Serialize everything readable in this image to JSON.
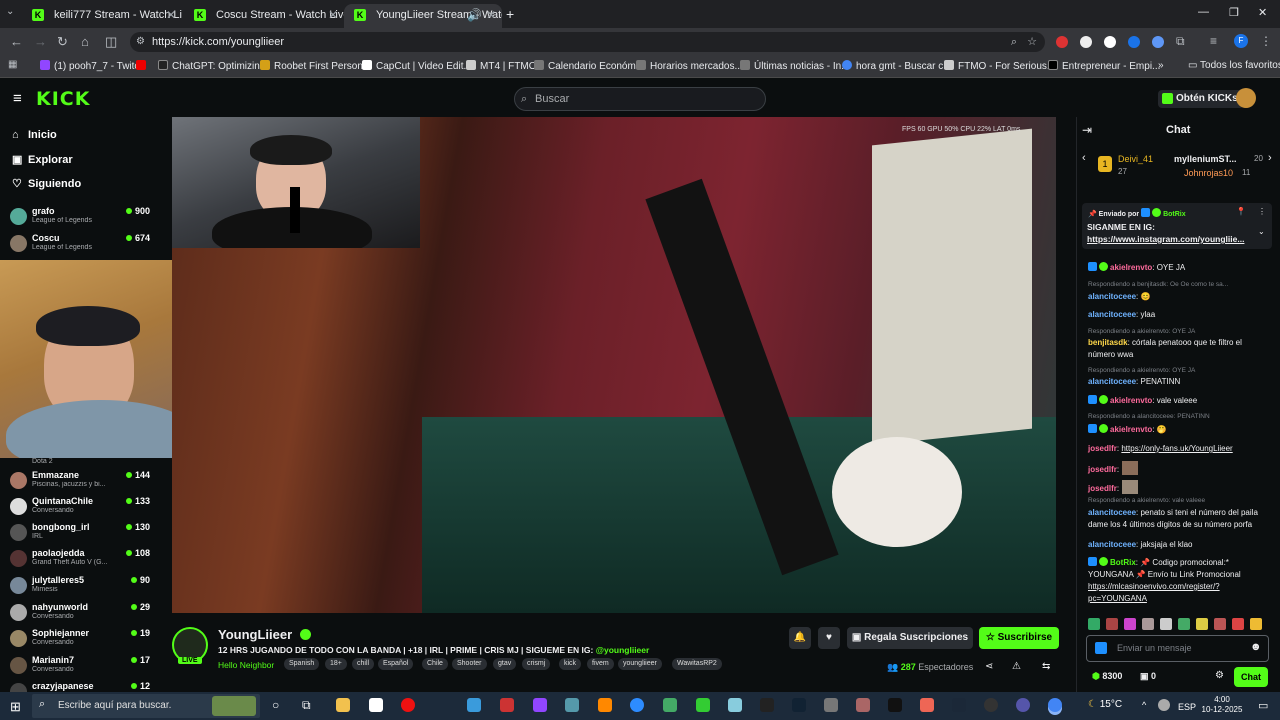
{
  "browser": {
    "tabs": [
      {
        "title": "keili777 Stream - Watch Live on Kick"
      },
      {
        "title": "Coscu Stream - Watch Live on Kick"
      },
      {
        "title": "YoungLiieer Stream - Watch Live on Kick"
      }
    ],
    "url": "https://kick.com/youngliieer",
    "bookmarks": [
      {
        "label": "(1) pooh7_7 - Twitch",
        "color": "#9146ff"
      },
      {
        "label": "ChatGPT: Optimizin...",
        "color": "#222"
      },
      {
        "label": "Roobet First Person...",
        "color": "#d4a017"
      },
      {
        "label": "CapCut | Video Edit...",
        "color": "#000"
      },
      {
        "label": "MT4 | FTMO",
        "color": "#ccc"
      },
      {
        "label": "Calendario Económi...",
        "color": "#555"
      },
      {
        "label": "Horarios mercados...",
        "color": "#555"
      },
      {
        "label": "Últimas noticias - In...",
        "color": "#555"
      },
      {
        "label": "hora gmt - Buscar c...",
        "color": "#4285f4"
      },
      {
        "label": "FTMO - For Serious...",
        "color": "#ccc"
      },
      {
        "label": "Entrepreneur - Empi...",
        "color": "#000"
      }
    ],
    "all_bookmarks": "Todos los favoritos"
  },
  "header": {
    "logo": "KICK",
    "search_placeholder": "Buscar",
    "get_kicks": "Obtén KICKs"
  },
  "sidebar": {
    "nav": [
      {
        "label": "Inicio",
        "icon": "⌂"
      },
      {
        "label": "Explorar",
        "icon": "▣"
      },
      {
        "label": "Siguiendo",
        "icon": "♡"
      }
    ],
    "channels_top": [
      {
        "name": "grafo",
        "category": "League of Legends",
        "viewers": "900",
        "color": "#5a9"
      },
      {
        "name": "Coscu",
        "category": "League of Legends",
        "viewers": "674",
        "color": "#876"
      }
    ],
    "partial_category": "Dota 2",
    "channels": [
      {
        "name": "Emmazane",
        "category": "Piscinas, jacuzzis y bi...",
        "viewers": "144",
        "color": "#a76"
      },
      {
        "name": "QuintanaChile",
        "category": "Conversando",
        "viewers": "133",
        "color": "#ddd"
      },
      {
        "name": "bongbong_irl",
        "category": "IRL",
        "viewers": "130",
        "color": "#555"
      },
      {
        "name": "paolaojedda",
        "category": "Grand Theft Auto V (G...",
        "viewers": "108",
        "color": "#533"
      },
      {
        "name": "julytalleres5",
        "category": "Mimesis",
        "viewers": "90",
        "color": "#789"
      },
      {
        "name": "nahyunworld",
        "category": "Conversando",
        "viewers": "29",
        "color": "#aaa"
      },
      {
        "name": "Sophiejanner",
        "category": "Conversando",
        "viewers": "19",
        "color": "#986"
      },
      {
        "name": "Marianin7",
        "category": "Conversando",
        "viewers": "17",
        "color": "#654"
      },
      {
        "name": "crazyjapanese",
        "category": "",
        "viewers": "12",
        "color": "#444"
      }
    ]
  },
  "video": {
    "hud": "FPS 60   GPU 50%   CPU 22%   LAT 0ms"
  },
  "stream": {
    "name": "YoungLiieer",
    "live": "LIVE",
    "title": "12 HRS JUGANDO DE TODO CON LA BANDA | +18 | IRL | PRIME | CRIS MJ | SIGUEME EN IG: ",
    "ig": "@youngliieer",
    "game": "Hello Neighbor",
    "tags": [
      "Spanish",
      "18+",
      "chill",
      "Español",
      "Chile",
      "Shooter",
      "gtav",
      "crismj",
      "kick",
      "fivem",
      "youngliieer",
      "WawitasRP2"
    ],
    "gift_subs": "Regala Suscripciones",
    "subscribe": "Suscribirse",
    "viewers": "287",
    "viewers_label": "Espectadores"
  },
  "chat": {
    "title": "Chat",
    "leaderboard": [
      {
        "name": "Deivi_41",
        "count": "27"
      },
      {
        "name": "mylleniumST...",
        "count": "20"
      },
      {
        "name": "Johnrojas10",
        "count": "11"
      }
    ],
    "pinned_by": "Enviado por",
    "pinned_user": "BotRix",
    "pinned_text": "SIGANME EN IG:",
    "pinned_link": "https://www.instagram.com/youngliie...",
    "messages": [
      {
        "reply": "",
        "user": "akielrenvto",
        "color": "#ff6b9d",
        "text": ": OYE JA",
        "badge": true
      },
      {
        "reply": "Respondiendo a benjitasdk: Oe Oe como te sa...",
        "user": "alancitoceee",
        "color": "#6fb3ff",
        "text": ": 😊",
        "badge": false
      },
      {
        "reply": "",
        "user": "alancitoceee",
        "color": "#6fb3ff",
        "text": ": ylaa",
        "badge": false
      },
      {
        "reply": "Respondiendo a akielrenvto: OYE JA",
        "user": "benjitasdk",
        "color": "#ffd84a",
        "text": ": córtala penatooo que te filtro el número wwa",
        "badge": false
      },
      {
        "reply": "Respondiendo a akielrenvto: OYE JA",
        "user": "alancitoceee",
        "color": "#6fb3ff",
        "text": ": PENATINN",
        "badge": false
      },
      {
        "reply": "",
        "user": "akielrenvto",
        "color": "#ff6b9d",
        "text": ": vale valeee",
        "badge": true
      },
      {
        "reply": "Respondiendo a alancitoceee: PENATINN",
        "user": "akielrenvto",
        "color": "#ff6b9d",
        "text": ": 🤭",
        "badge": true
      },
      {
        "reply": "",
        "user": "josedlfr",
        "color": "#ff6b9d",
        "text": ": ",
        "link": "https://only-fans.uk/YoungLiieer",
        "badge": false
      },
      {
        "reply": "",
        "user": "josedlfr",
        "color": "#ff6b9d",
        "text": ":",
        "badge": false
      },
      {
        "reply": "",
        "user": "josedlfr",
        "color": "#ff6b9d",
        "text": ":",
        "badge": false
      },
      {
        "reply": "Respondiendo a akielrenvto: vale valeee",
        "user": "alancitoceee",
        "color": "#6fb3ff",
        "text": ": penato si teni el número del paila dame los 4 últimos dígitos de su número porfa",
        "badge": false
      },
      {
        "reply": "",
        "user": "alancitoceee",
        "color": "#6fb3ff",
        "text": ": jaksjaja el klao",
        "badge": false
      },
      {
        "reply": "",
        "user": "BotRix",
        "color": "#53fc18",
        "text": ": 📌 Codigo promocional:* YOUNGANA 📌 Envío tu Link Promocional",
        "link": "https://mlcasinoenvivo.com/register/?pc=YOUNGANA",
        "badge": true
      }
    ],
    "input_placeholder": "Enviar un mensaje",
    "points": "8300",
    "gifts": "0",
    "send": "Chat"
  },
  "taskbar": {
    "search_placeholder": "Escribe aquí para buscar.",
    "temperature": "15°C",
    "lang": "ESP",
    "time": "4:00",
    "date": "10-12-2025"
  }
}
